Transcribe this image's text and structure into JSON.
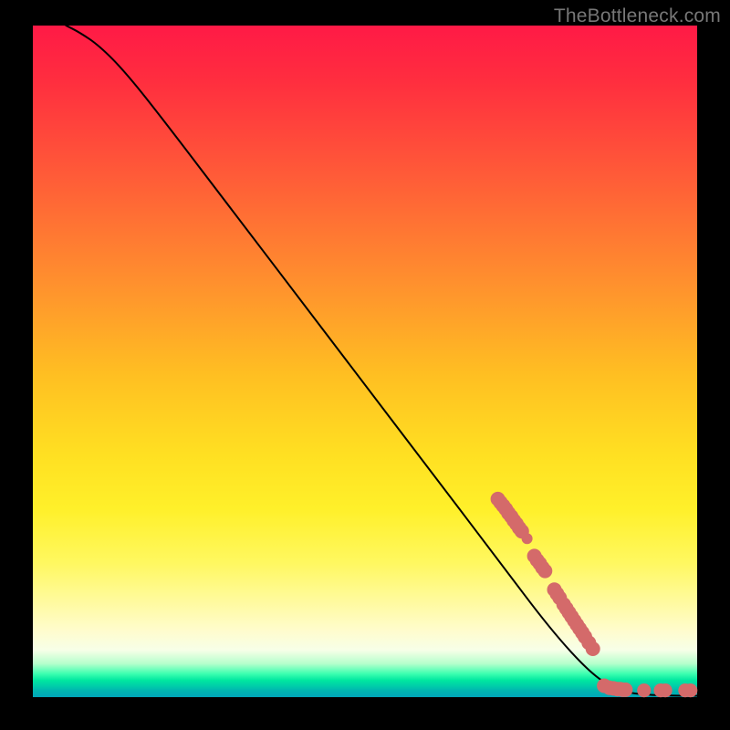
{
  "watermark": "TheBottleneck.com",
  "chart_data": {
    "type": "line",
    "title": "",
    "xlabel": "",
    "ylabel": "",
    "xlim": [
      0,
      100
    ],
    "ylim": [
      0,
      100
    ],
    "curve": [
      {
        "x": 5.0,
        "y": 100.0
      },
      {
        "x": 7.0,
        "y": 99.0
      },
      {
        "x": 10.0,
        "y": 97.0
      },
      {
        "x": 14.0,
        "y": 93.0
      },
      {
        "x": 20.0,
        "y": 85.5
      },
      {
        "x": 30.0,
        "y": 72.5
      },
      {
        "x": 40.0,
        "y": 59.5
      },
      {
        "x": 50.0,
        "y": 46.5
      },
      {
        "x": 60.0,
        "y": 33.5
      },
      {
        "x": 70.0,
        "y": 20.5
      },
      {
        "x": 78.0,
        "y": 10.0
      },
      {
        "x": 84.0,
        "y": 3.5
      },
      {
        "x": 88.0,
        "y": 1.0
      },
      {
        "x": 92.0,
        "y": 0.3
      },
      {
        "x": 100.0,
        "y": 0.2
      }
    ],
    "markers": [
      {
        "x": 70.0,
        "y": 29.5,
        "r": 1.1
      },
      {
        "x": 70.4,
        "y": 29.0,
        "r": 1.1
      },
      {
        "x": 70.8,
        "y": 28.5,
        "r": 1.1
      },
      {
        "x": 71.2,
        "y": 28.0,
        "r": 1.1
      },
      {
        "x": 71.6,
        "y": 27.4,
        "r": 1.1
      },
      {
        "x": 72.0,
        "y": 26.9,
        "r": 1.1
      },
      {
        "x": 72.4,
        "y": 26.3,
        "r": 1.1
      },
      {
        "x": 72.8,
        "y": 25.8,
        "r": 1.1
      },
      {
        "x": 73.2,
        "y": 25.2,
        "r": 1.1
      },
      {
        "x": 73.6,
        "y": 24.7,
        "r": 1.1
      },
      {
        "x": 74.4,
        "y": 23.6,
        "r": 0.6
      },
      {
        "x": 75.5,
        "y": 21.0,
        "r": 1.1
      },
      {
        "x": 75.9,
        "y": 20.4,
        "r": 1.1
      },
      {
        "x": 76.3,
        "y": 19.9,
        "r": 1.1
      },
      {
        "x": 76.7,
        "y": 19.3,
        "r": 1.1
      },
      {
        "x": 77.1,
        "y": 18.8,
        "r": 1.1
      },
      {
        "x": 78.5,
        "y": 16.0,
        "r": 1.1
      },
      {
        "x": 78.9,
        "y": 15.4,
        "r": 1.1
      },
      {
        "x": 79.3,
        "y": 14.8,
        "r": 1.1
      },
      {
        "x": 79.9,
        "y": 13.8,
        "r": 1.1
      },
      {
        "x": 80.3,
        "y": 13.2,
        "r": 1.1
      },
      {
        "x": 80.7,
        "y": 12.6,
        "r": 1.1
      },
      {
        "x": 81.1,
        "y": 12.0,
        "r": 1.1
      },
      {
        "x": 81.5,
        "y": 11.4,
        "r": 1.1
      },
      {
        "x": 81.9,
        "y": 10.8,
        "r": 1.1
      },
      {
        "x": 82.3,
        "y": 10.2,
        "r": 1.1
      },
      {
        "x": 82.7,
        "y": 9.6,
        "r": 1.1
      },
      {
        "x": 83.1,
        "y": 9.0,
        "r": 1.1
      },
      {
        "x": 83.7,
        "y": 8.1,
        "r": 1.1
      },
      {
        "x": 84.3,
        "y": 7.2,
        "r": 1.1
      },
      {
        "x": 86.0,
        "y": 1.7,
        "r": 1.1
      },
      {
        "x": 86.8,
        "y": 1.4,
        "r": 1.1
      },
      {
        "x": 87.4,
        "y": 1.3,
        "r": 1.1
      },
      {
        "x": 88.0,
        "y": 1.2,
        "r": 1.1
      },
      {
        "x": 88.4,
        "y": 1.2,
        "r": 1.1
      },
      {
        "x": 88.8,
        "y": 1.1,
        "r": 1.1
      },
      {
        "x": 89.2,
        "y": 1.1,
        "r": 1.1
      },
      {
        "x": 92.0,
        "y": 1.0,
        "r": 1.0
      },
      {
        "x": 94.5,
        "y": 1.0,
        "r": 1.0
      },
      {
        "x": 95.2,
        "y": 1.0,
        "r": 1.0
      },
      {
        "x": 98.2,
        "y": 1.0,
        "r": 1.0
      },
      {
        "x": 99.0,
        "y": 1.0,
        "r": 1.0
      }
    ]
  }
}
